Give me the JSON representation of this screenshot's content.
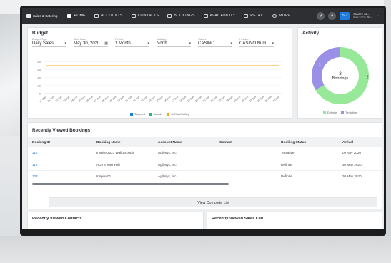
{
  "nav": {
    "logo": "Sales & Catering",
    "items": [
      {
        "label": "HOME",
        "active": true
      },
      {
        "label": "ACCOUNTS",
        "active": false
      },
      {
        "label": "CONTACTS",
        "active": false
      },
      {
        "label": "BOOKINGS",
        "active": false
      },
      {
        "label": "AVAILABILITY",
        "active": false
      },
      {
        "label": "RETAIL",
        "active": false
      },
      {
        "label": "MORE",
        "active": false
      }
    ],
    "user_initials": "SO",
    "user_name": "STACEY OB...",
    "user_role": "AGILYSYS INC..."
  },
  "budget": {
    "title": "Budget",
    "filters": [
      {
        "label": "Budget Type",
        "value": "Daily Sales",
        "icon": "chevron-down-icon"
      },
      {
        "label": "Start Date",
        "value": "May 30, 2020",
        "icon": "calendar-icon"
      },
      {
        "label": "Period",
        "value": "1 Month",
        "icon": "chevron-down-icon"
      },
      {
        "label": "Building",
        "value": "North",
        "icon": "chevron-down-icon"
      },
      {
        "label": "Values",
        "value": "CASINO",
        "icon": "chevron-down-icon"
      },
      {
        "label": "Headers",
        "value": "CASINO Num...",
        "icon": "chevron-down-icon"
      }
    ],
    "legend": [
      {
        "label": "Targeted",
        "color": "#1e7be0"
      },
      {
        "label": "Actuals",
        "color": "#2bb673"
      },
      {
        "label": "S-Chart/Ceiling",
        "color": "#f3a712"
      }
    ]
  },
  "chart_data": {
    "type": "line",
    "x": [
      "31 May",
      "01 Jun",
      "02 Jun",
      "03 Jun",
      "04 Jun",
      "05 Jun",
      "06 Jun",
      "07 Jun",
      "08 Jun",
      "09 Jun",
      "10 Jun",
      "11 Jun",
      "12 Jun",
      "13 Jun",
      "14 Jun",
      "15 Jun",
      "16 Jun",
      "17 Jun",
      "18 Jun",
      "19 Jun",
      "20 Jun",
      "21 Jun",
      "22 Jun",
      "23 Jun",
      "24 Jun",
      "25 Jun",
      "26 Jun",
      "27 Jun",
      "28 Jun",
      "29 Jun",
      "30 Jun"
    ],
    "series": [
      {
        "name": "S-Chart/Ceiling",
        "values": [
          70,
          70,
          70,
          70,
          70,
          70,
          70,
          70,
          70,
          70,
          70,
          70,
          70,
          70,
          70,
          70,
          70,
          70,
          70,
          70,
          70,
          70,
          70,
          70,
          70,
          70,
          70,
          70,
          70,
          70,
          70
        ],
        "color": "#f3a712"
      }
    ],
    "yticks": [
      0,
      20,
      40,
      60,
      80
    ],
    "ylim": [
      0,
      90
    ],
    "grid": true
  },
  "activity": {
    "title": "Activity",
    "center_count": "3",
    "center_label": "Bookings",
    "slices": [
      {
        "label": "Definite",
        "value": 2,
        "color": "#98e89a"
      },
      {
        "label": "Tentative",
        "value": 1,
        "color": "#9a90e6"
      }
    ],
    "slice_labels": [
      "1",
      "2"
    ]
  },
  "recent_bookings": {
    "title": "Recently Viewed Bookings",
    "columns": [
      "Booking ID",
      "Booking Name",
      "Account Name",
      "Contact",
      "Booking Status",
      "Arrival"
    ],
    "rows": [
      [
        "110",
        "Inspire 2021 Walkthrough",
        "Agilysys, Inc",
        "",
        "Tentative",
        "09 Nov 2020"
      ],
      [
        "112",
        "AGYS TownHall",
        "Agilysys, Inc",
        "",
        "Definite",
        "30 May 2020"
      ],
      [
        "104",
        "Inspire 01",
        "Agilysys, Inc",
        "",
        "Definite",
        "30 May 2020"
      ]
    ],
    "view_all": "View Complete List"
  },
  "recent_contacts": {
    "title": "Recently Viewed Contacts"
  },
  "recent_sales": {
    "title": "Recently Viewed Sales Call"
  }
}
